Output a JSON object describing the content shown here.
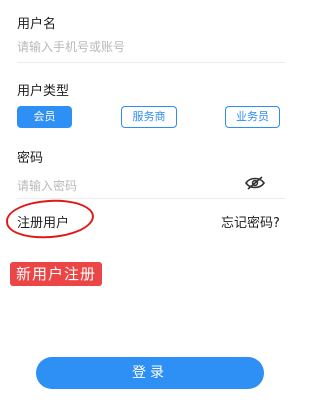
{
  "username": {
    "label": "用户名",
    "placeholder": "请输入手机号或账号"
  },
  "user_type": {
    "label": "用户类型",
    "options": [
      "会员",
      "服务商",
      "业务员"
    ],
    "selected": "会员",
    "accent_color": "#2e8ff4"
  },
  "password": {
    "label": "密码",
    "placeholder": "请输入密码",
    "toggle_icon": "eye-off-icon"
  },
  "links": {
    "register": "注册用户",
    "forgot": "忘记密码?"
  },
  "annotation": {
    "text": "新用户注册",
    "color": "#eb4545"
  },
  "submit": {
    "label": "登录"
  }
}
